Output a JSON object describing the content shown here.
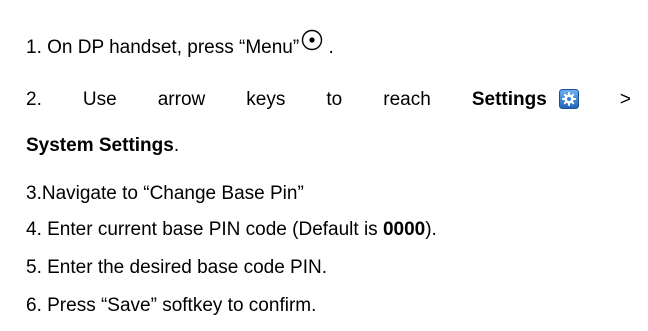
{
  "steps": {
    "s1": {
      "text": "1. On DP handset, press “Menu”",
      "tail": " ."
    },
    "s2": {
      "w1": "2.",
      "w2": "Use",
      "w3": "arrow",
      "w4": "keys",
      "w5": "to",
      "w6": "reach",
      "bold1": "Settings",
      "sep": ">",
      "bold2": "System Settings",
      "end": "."
    },
    "s3": {
      "text": "3.Navigate to “Change Base Pin”"
    },
    "s4": {
      "pre": "4. Enter current base PIN code (Default is ",
      "bold": "0000",
      "post": ")."
    },
    "s5": {
      "text": "5. Enter the desired base code PIN."
    },
    "s6": {
      "text": "6. Press “Save” softkey to confirm."
    }
  },
  "icons": {
    "menu": "menu-button-icon",
    "settings": "settings-gear-icon"
  },
  "colors": {
    "text": "#000000",
    "gear_bg": "#2f7fd6"
  }
}
